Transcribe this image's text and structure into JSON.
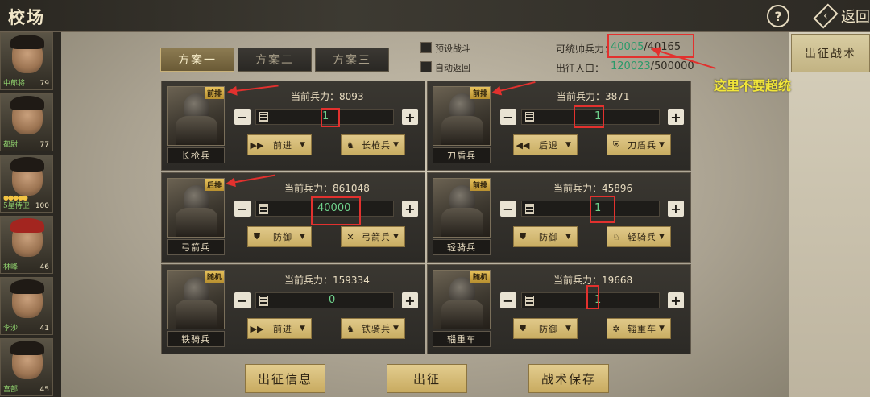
{
  "header": {
    "title": "校场",
    "help_label": "?",
    "back_label": "返回"
  },
  "sidebar": {
    "generals": [
      {
        "name": "中郎将",
        "level": "79"
      },
      {
        "name": "都尉",
        "level": "77"
      },
      {
        "name": "5星侍卫",
        "level": "100"
      },
      {
        "name": "林峰",
        "level": "46"
      },
      {
        "name": "李沙",
        "level": "41"
      },
      {
        "name": "宫部",
        "level": "45"
      }
    ]
  },
  "plan_tabs": [
    "方案一",
    "方案二",
    "方案三"
  ],
  "options": {
    "preset_label": "预设战斗",
    "auto_return_label": "自动返回"
  },
  "stats": {
    "commandable_label": "可统帅兵力：",
    "commandable_used": "40005",
    "commandable_total": "/40165",
    "population_label": "出征人口：",
    "population_used": "120023",
    "population_total": "/500000"
  },
  "tactic_button": "出征战术",
  "annotation": "这里不要超统",
  "force_label": "当前兵力：",
  "units": [
    {
      "name": "长枪兵",
      "badge": "前排",
      "force": "8093",
      "count": "1",
      "action": "前进",
      "type_label": "长枪兵",
      "action_icon": "advance-icon",
      "type_icon": "spear-icon"
    },
    {
      "name": "刀盾兵",
      "badge": "前排",
      "force": "3871",
      "count": "1",
      "action": "后退",
      "type_label": "刀盾兵",
      "action_icon": "retreat-icon",
      "type_icon": "shield-icon"
    },
    {
      "name": "弓箭兵",
      "badge": "后排",
      "force": "861048",
      "count": "40000",
      "action": "防御",
      "type_label": "弓箭兵",
      "action_icon": "defend-icon",
      "type_icon": "bow-icon"
    },
    {
      "name": "轻骑兵",
      "badge": "前排",
      "force": "45896",
      "count": "1",
      "action": "防御",
      "type_label": "轻骑兵",
      "action_icon": "defend-icon",
      "type_icon": "horse-icon"
    },
    {
      "name": "铁骑兵",
      "badge": "随机",
      "force": "159334",
      "count": "0",
      "action": "前进",
      "type_label": "铁骑兵",
      "action_icon": "advance-icon",
      "type_icon": "horse-icon"
    },
    {
      "name": "辎重车",
      "badge": "随机",
      "force": "19668",
      "count": "1",
      "action": "防御",
      "type_label": "辎重车",
      "action_icon": "defend-icon",
      "type_icon": "wheel-icon"
    }
  ],
  "bottom_buttons": {
    "info": "出征信息",
    "go": "出征",
    "save": "战术保存"
  },
  "colors": {
    "accent_gold": "#c9ad62",
    "highlight_green": "#6fd28c",
    "annotation_yellow": "#f2e63a",
    "marker_red": "#e2312e"
  }
}
